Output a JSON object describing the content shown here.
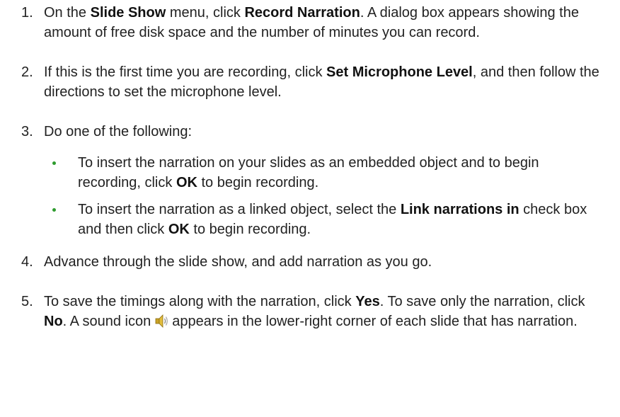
{
  "steps": [
    {
      "num": "1.",
      "parts": [
        "On the ",
        "Slide Show",
        " menu, click ",
        "Record Narration",
        ". A dialog box appears showing the amount of free disk space and the number of minutes you can record."
      ]
    },
    {
      "num": "2.",
      "parts": [
        "If this is the first time you are recording, click ",
        "Set Microphone Level",
        ", and then follow the directions to set the microphone level."
      ]
    },
    {
      "num": "3.",
      "text": "Do one of the following:",
      "subs": [
        {
          "parts": [
            "To insert the narration on your slides as an embedded object and to begin recording, click ",
            "OK",
            " to begin recording."
          ]
        },
        {
          "parts": [
            "To insert the narration as a linked object, select the ",
            "Link narrations in",
            " check box and then click ",
            "OK",
            " to begin recording."
          ]
        }
      ]
    },
    {
      "num": "4.",
      "text": "Advance through the slide show, and add narration as you go."
    },
    {
      "num": "5.",
      "parts": [
        "To save the timings along with the narration, click ",
        "Yes",
        ". To save only the narration, click ",
        "No",
        ". A sound icon",
        "appears in the lower-right corner of each slide that has narration."
      ]
    }
  ],
  "icons": {
    "sound": "speaker-icon"
  },
  "colors": {
    "bullet": "#2e9b2e",
    "text": "#222222"
  }
}
